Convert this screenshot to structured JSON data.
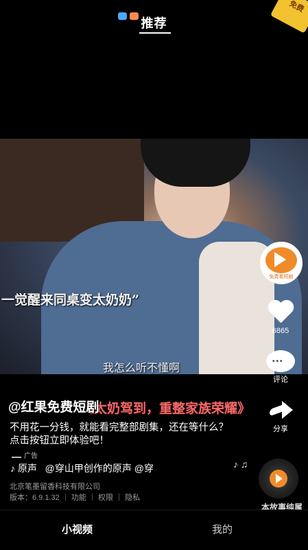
{
  "top_nav": {
    "active_tab": "推荐"
  },
  "corner_badge": "免费",
  "video": {
    "caption_top": "一觉醒来同桌变太奶奶”",
    "subtitle": "我怎么听不懂啊"
  },
  "banner": {
    "scrolling_text": "《太奶驾到，重整家族荣耀》",
    "tag": "@红果免费短剧"
  },
  "description": "不用花一分钱，就能看完整部剧集，还在等什么？点击按钮立即体验吧！",
  "ad_label": "广告",
  "music": {
    "label": "原声",
    "text": "@穿山甲创作的原声    @穿"
  },
  "company": "北京笔墨留香科技有限公司",
  "version_line": "版本：6.9.1.32 ｜ 功能 ｜ 权限 ｜ 隐私",
  "watermark": "本故事纯属",
  "side": {
    "avatar_small_text": "免费看短剧",
    "like_count": "6865",
    "comment_label": "评论",
    "share_label": "分享"
  },
  "bottom_nav": {
    "home": "小视频",
    "me": "我的"
  },
  "colors": {
    "accent": "#f08b2a",
    "banner_red": "#f06a6a"
  }
}
